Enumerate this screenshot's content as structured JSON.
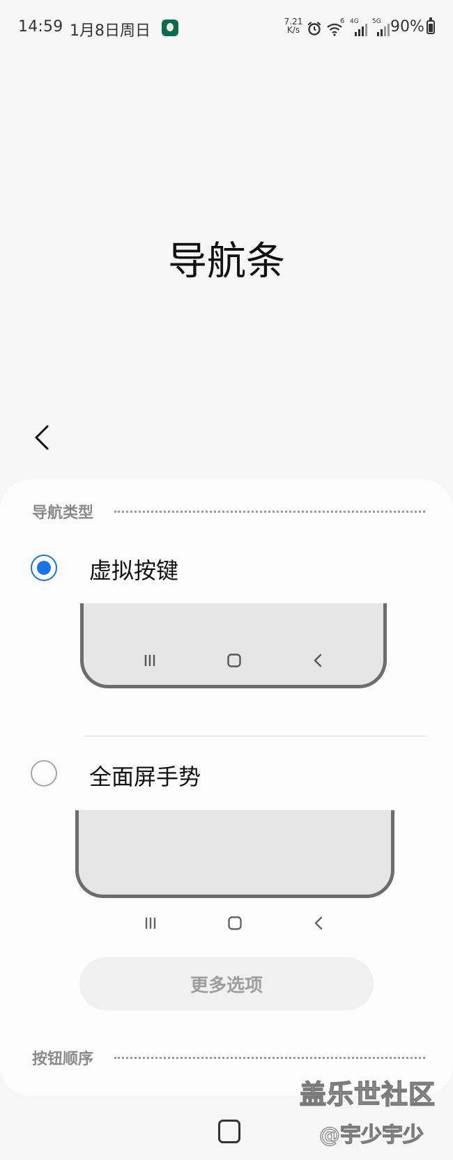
{
  "status_bar": {
    "time": "14:59",
    "date": "1月8日周日",
    "net_speed_value": "7.21",
    "net_speed_unit": "K/s",
    "wifi_badge": "6",
    "signal_1_label": "4G",
    "signal_2_label": "5G",
    "battery": "90%"
  },
  "page": {
    "title": "导航条"
  },
  "nav_type_section": {
    "header": "导航类型",
    "options": [
      {
        "label": "虚拟按键",
        "selected": true
      },
      {
        "label": "全面屏手势",
        "selected": false
      }
    ],
    "more_options_label": "更多选项"
  },
  "button_order_section": {
    "header": "按钮顺序"
  },
  "watermark": {
    "main": "盖乐世社区",
    "sub": "@宇少宇少"
  },
  "icons": {
    "back": "chevron-left-icon",
    "recents": "recents-icon",
    "home": "home-icon",
    "nav_back": "nav-back-icon",
    "alarm": "alarm-icon",
    "wifi": "wifi-icon",
    "signal": "signal-icon",
    "battery": "battery-icon"
  },
  "colors": {
    "accent": "#1a73e8",
    "background": "#f6f6f6",
    "card": "#fcfcfc",
    "section_header": "#8a8a8a"
  }
}
